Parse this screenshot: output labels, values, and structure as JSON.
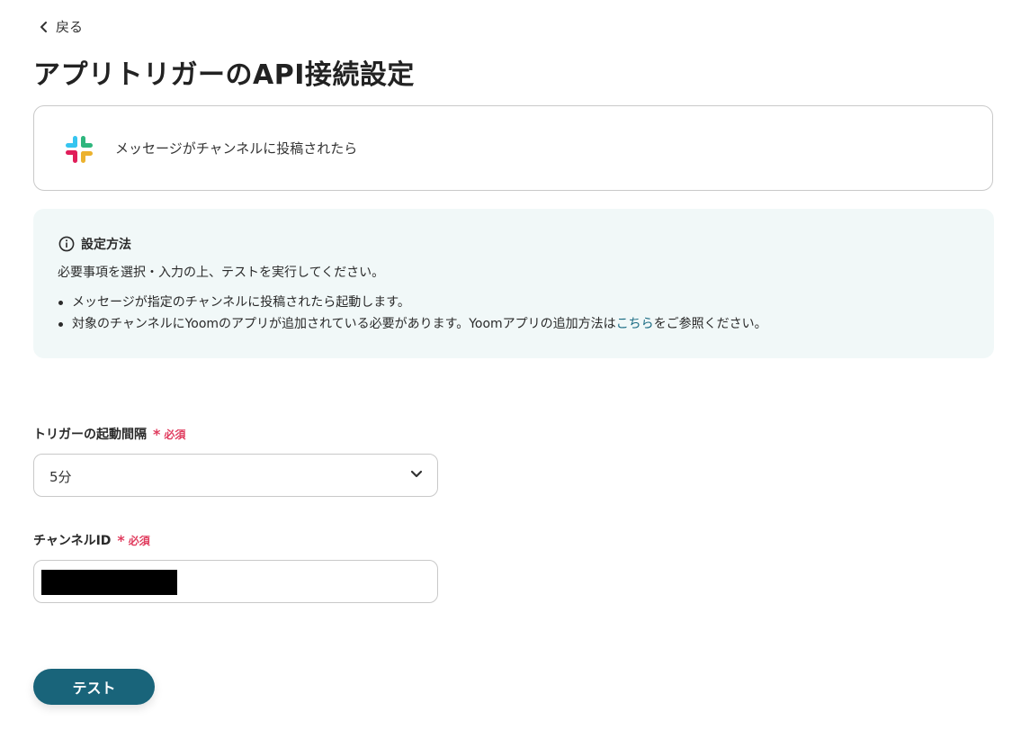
{
  "nav": {
    "back_label": "戻る"
  },
  "page": {
    "title": "アプリトリガーのAPI接続設定"
  },
  "trigger": {
    "app_icon": "slack-logo",
    "label": "メッセージがチャンネルに投稿されたら"
  },
  "info": {
    "icon": "info-icon",
    "heading": "設定方法",
    "description": "必要事項を選択・入力の上、テストを実行してください。",
    "bullets": [
      {
        "text": "メッセージが指定のチャンネルに投稿されたら起動します。"
      },
      {
        "text_before": "対象のチャンネルにYoomのアプリが追加されている必要があります。Yoomアプリの追加方法は",
        "link": "こちら",
        "text_after": "をご参照ください。"
      }
    ]
  },
  "form": {
    "interval": {
      "label": "トリガーの起動間隔",
      "required_mark": "*",
      "required_text": "必須",
      "value": "5分"
    },
    "channel_id": {
      "label": "チャンネルID",
      "required_mark": "*",
      "required_text": "必須",
      "value_redacted": true
    }
  },
  "actions": {
    "test_label": "テスト"
  },
  "colors": {
    "accent": "#19647a",
    "link": "#1a6b83",
    "required": "#e03c5e",
    "info_bg": "#f1f8f8",
    "border": "#c9c9c9"
  }
}
